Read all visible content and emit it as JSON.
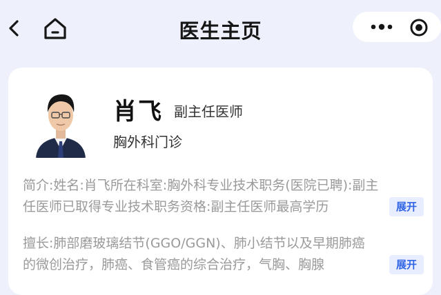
{
  "nav": {
    "title": "医生主页"
  },
  "doctor": {
    "name": "肖飞",
    "title": "副主任医师",
    "department": "胸外科门诊"
  },
  "intro": {
    "line1": "简介:姓名:肖飞所在科室:胸外科专业技术职务(医院已聘):副主",
    "line2": "任医师已取得专业技术职务资格:副主任医师最高学历",
    "expand_label": "展开"
  },
  "expertise": {
    "line1": "擅长:肺部磨玻璃结节(GGO/GGN)、肺小结节以及早期肺癌",
    "line2": "的微创治疗，肺癌、食管癌的综合治疗，气胸、胸腺",
    "expand_label": "展开"
  },
  "icons": [
    "back-icon",
    "home-icon",
    "more-icon",
    "close-target-icon"
  ],
  "colors": {
    "page_bg": "#eef0fb",
    "accent": "#2f64e6",
    "expand_bg": "#e8edff"
  }
}
